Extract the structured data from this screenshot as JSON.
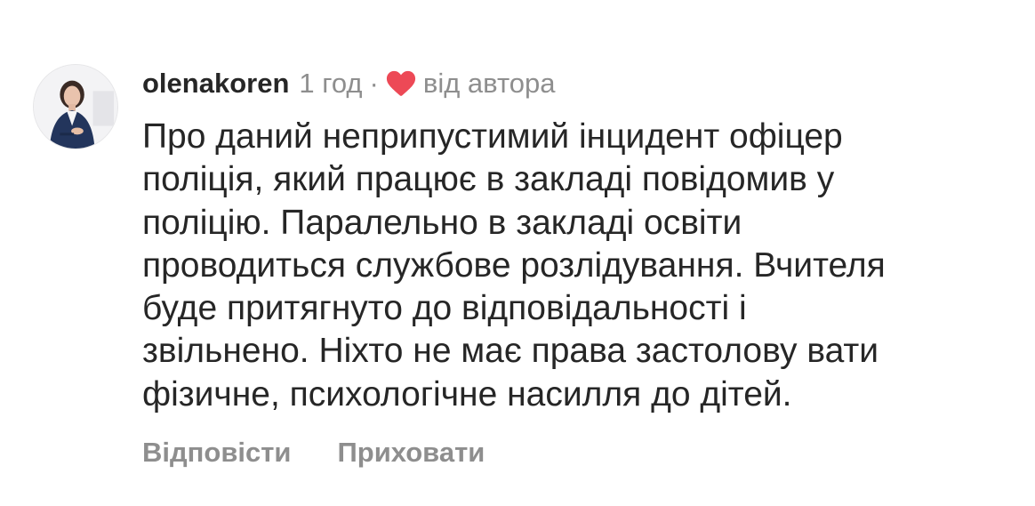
{
  "comment": {
    "username": "olenakoren",
    "time": "1 год",
    "separator": "·",
    "liked_by_author_label": "від автора",
    "heart_color": "#ed4956",
    "heart_icon": "heart-icon",
    "text_lines": [
      "Про даний неприпустимий інцидент офіцер",
      "поліція, який працює в закладі повідомив у",
      "поліцію. Паралельно в закладі освіти",
      "проводиться службове розлідування. Вчителя",
      "буде притягнуто до відповідальності і",
      "звільнено. Ніхто не має права застолову вати",
      "фізичне, психологічне насилля до дітей."
    ],
    "actions": {
      "reply_label": "Відповісти",
      "hide_label": "Приховати"
    }
  },
  "colors": {
    "text": "#262626",
    "secondary": "#8e8e8e",
    "background": "#ffffff"
  }
}
